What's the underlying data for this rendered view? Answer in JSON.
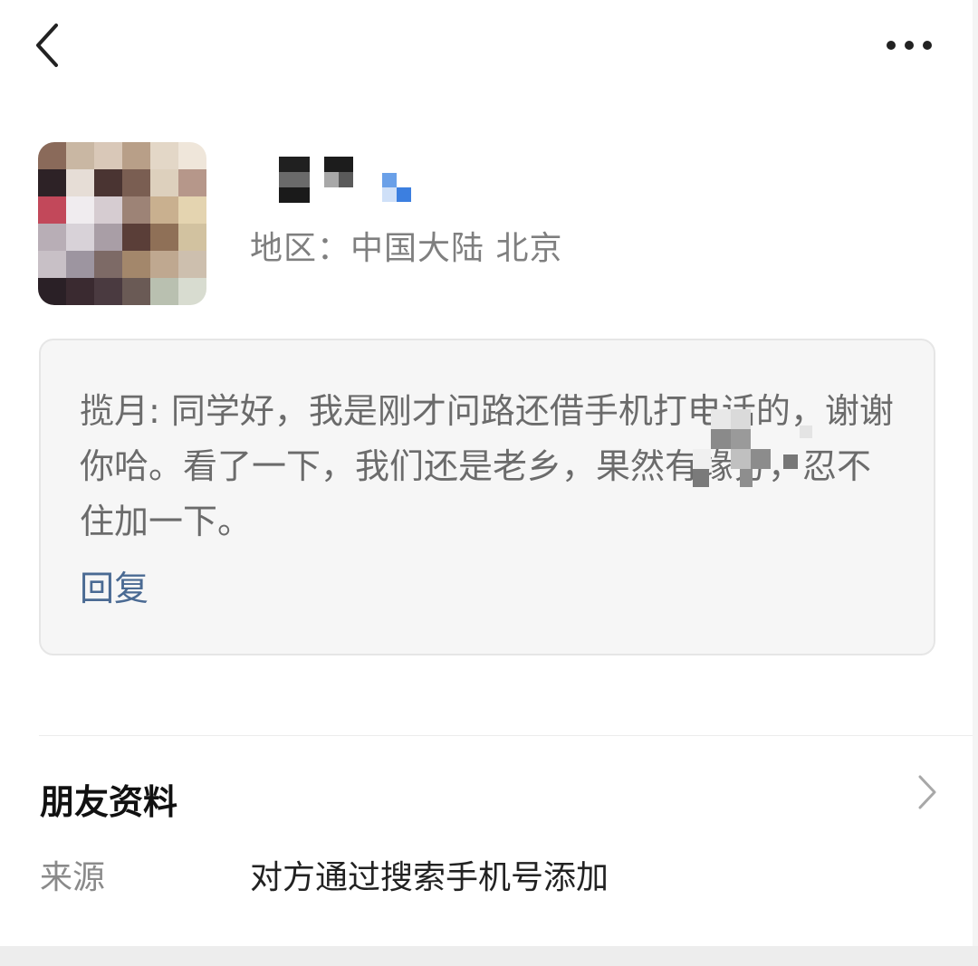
{
  "header": {
    "back_icon": "chevron-left-icon",
    "more_icon": "more-horizontal-icon"
  },
  "profile": {
    "region": "地区：中国大陆  北京"
  },
  "greeting": {
    "text": "揽月: 同学好，我是刚才问路还借手机打电话的，谢谢你哈。看了一下，我们还是老乡，果然有缘分，忍不住加一下。",
    "reply_label": "回复"
  },
  "friend_info": {
    "title": "朋友资料",
    "source_label": "来源",
    "source_value": "对方通过搜索手机号添加"
  },
  "colors": {
    "link": "#4a6a93",
    "card_bg": "#f6f6f6",
    "muted_text": "#7f7f7f"
  }
}
